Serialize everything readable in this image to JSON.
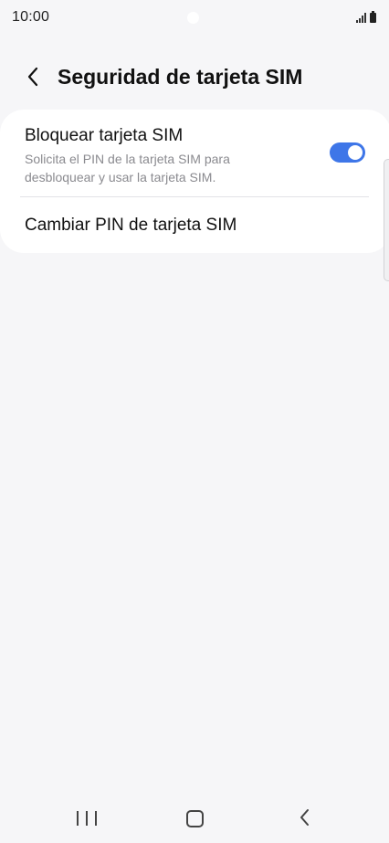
{
  "status_bar": {
    "time": "10:00",
    "icons": [
      "signal-icon",
      "battery-icon"
    ]
  },
  "header": {
    "back_icon": "chevron-left-icon",
    "title": "Seguridad de tarjeta SIM"
  },
  "settings": {
    "lock_sim": {
      "title": "Bloquear tarjeta SIM",
      "description": "Solicita el PIN de la tarjeta SIM para desbloquear y usar la tarjeta SIM.",
      "enabled": true
    },
    "change_pin": {
      "label": "Cambiar PIN de tarjeta SIM"
    }
  },
  "nav_bar": {
    "icons": [
      "recents-icon",
      "home-icon",
      "back-icon"
    ]
  },
  "colors": {
    "background": "#f6f6f8",
    "card": "#ffffff",
    "accent": "#3e76e8",
    "secondary_text": "#8a8a8f"
  }
}
